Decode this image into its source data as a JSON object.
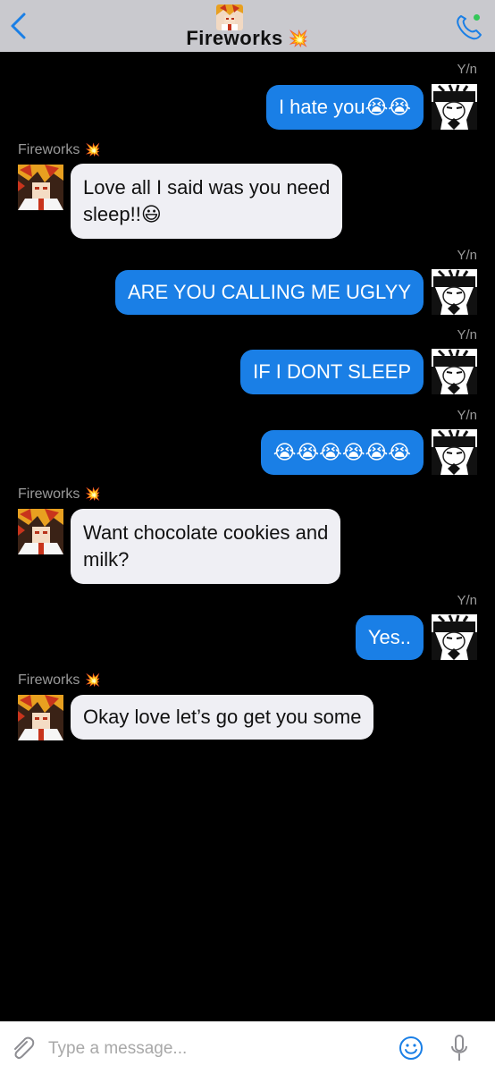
{
  "header": {
    "title": "Fireworks",
    "title_emoji": "💥",
    "back_icon": "chevron-left-icon",
    "call_icon": "phone-icon",
    "online_color": "#34c759"
  },
  "messages": [
    {
      "side": "out",
      "sender": "Y/n",
      "text": "I hate you😭😭"
    },
    {
      "side": "in",
      "sender": "Fireworks",
      "sender_emoji": "💥",
      "text_line1": "Love all I said was you need",
      "text_line2": "sleep!!😃"
    },
    {
      "side": "out",
      "sender": "Y/n",
      "text": "ARE YOU CALLING ME UGLYY"
    },
    {
      "side": "out",
      "sender": "Y/n",
      "text": "IF I DONT SLEEP"
    },
    {
      "side": "out",
      "sender": "Y/n",
      "text": "😭😭😭😭😭😭"
    },
    {
      "side": "in",
      "sender": "Fireworks",
      "sender_emoji": "💥",
      "text_line1": "Want chocolate cookies and",
      "text_line2": "milk?"
    },
    {
      "side": "out",
      "sender": "Y/n",
      "text": "Yes.."
    },
    {
      "side": "in",
      "sender": "Fireworks",
      "sender_emoji": "💥",
      "text": "Okay love let’s go get you some"
    }
  ],
  "colors": {
    "outgoing_bubble": "#1a7fe6",
    "incoming_bubble": "#efeff4",
    "header_bg": "#c9c9ce",
    "accent": "#1a7fe6"
  },
  "composer": {
    "placeholder": "Type a message...",
    "attach_icon": "paperclip-icon",
    "emoji_icon": "smiley-icon",
    "mic_icon": "microphone-icon"
  }
}
